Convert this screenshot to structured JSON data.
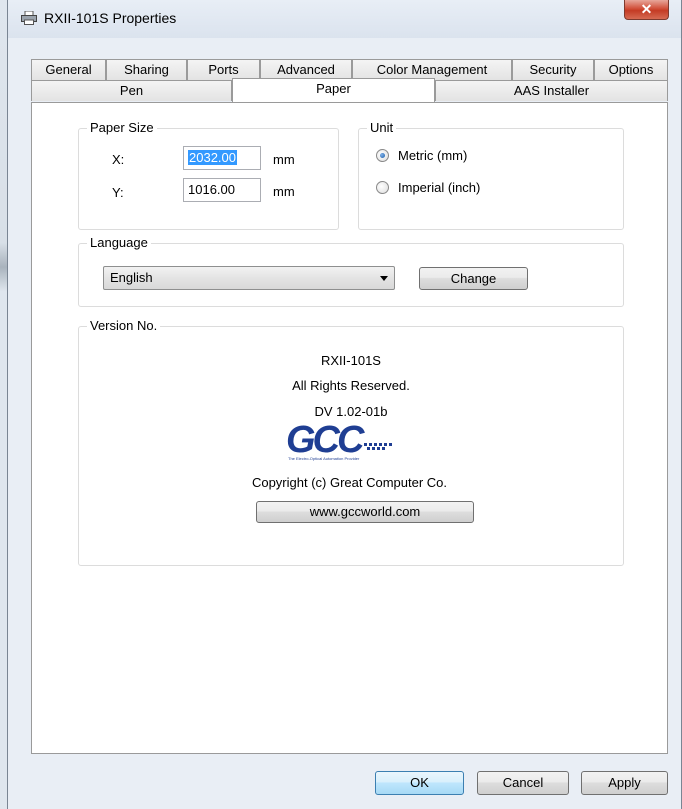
{
  "window": {
    "title": "RXII-101S Properties",
    "close_glyph": "✕",
    "title_icon": "printer-icon"
  },
  "tabs": {
    "row1": [
      "General",
      "Sharing",
      "Ports",
      "Advanced",
      "Color Management",
      "Security",
      "Options"
    ],
    "row2": [
      "Pen",
      "Paper",
      "AAS Installer"
    ],
    "selected": "Paper"
  },
  "paper_size": {
    "label": "Paper Size",
    "x_label": "X:",
    "x_value": "2032.00",
    "x_unit": "mm",
    "y_label": "Y:",
    "y_value": "1016.00",
    "y_unit": "mm"
  },
  "unit": {
    "label": "Unit",
    "options": [
      "Metric (mm)",
      "Imperial (inch)"
    ],
    "selected": "Metric (mm)"
  },
  "language": {
    "label": "Language",
    "selected": "English",
    "change_button": "Change"
  },
  "version": {
    "label": "Version No.",
    "model": "RXII-101S",
    "rights": "All Rights Reserved.",
    "driver_version": "DV 1.02-01b",
    "logo_text": "GCC",
    "logo_tagline": "The Electro-Optical Automation Provider",
    "copyright": "Copyright (c) Great Computer Co.",
    "website_button": "www.gccworld.com"
  },
  "footer": {
    "ok": "OK",
    "cancel": "Cancel",
    "apply": "Apply"
  },
  "colors": {
    "selection": "#3399ff",
    "logo_blue": "#1f3e93",
    "window_bg": "#e9eef5"
  }
}
